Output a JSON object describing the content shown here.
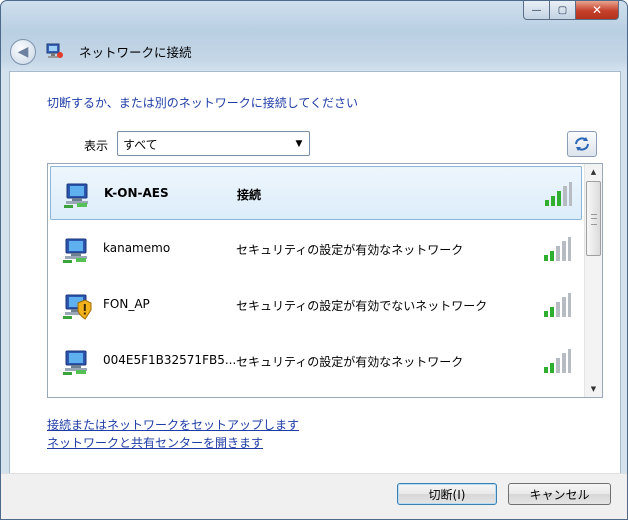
{
  "window": {
    "title": "ネットワークに接続",
    "caption_buttons": {
      "minimize": "minimize-icon",
      "maximize": "maximize-icon",
      "close": "close-icon"
    }
  },
  "instruction": "切断するか、または別のネットワークに接続してください",
  "filter": {
    "label": "表示",
    "selected": "すべて"
  },
  "networks": [
    {
      "name": "K-ON-AES",
      "status": "接続",
      "selected": true,
      "icon": "network-connected-icon"
    },
    {
      "name": "kanamemo",
      "status": "セキュリティの設定が有効なネットワーク",
      "selected": false,
      "icon": "network-icon"
    },
    {
      "name": "FON_AP",
      "status": "セキュリティの設定が有効でないネットワーク",
      "selected": false,
      "icon": "network-unsecured-icon"
    },
    {
      "name": "004E5F1B32571FB5...",
      "status": "セキュリティの設定が有効なネットワーク",
      "selected": false,
      "icon": "network-icon"
    }
  ],
  "links": {
    "setup": "接続またはネットワークをセットアップします",
    "sharing_center": "ネットワークと共有センターを開きます"
  },
  "buttons": {
    "disconnect": "切断(I)",
    "cancel": "キャンセル"
  },
  "colors": {
    "link": "#1e3ca6",
    "selection": "#dcedfa",
    "signal": "#2fae2f"
  }
}
